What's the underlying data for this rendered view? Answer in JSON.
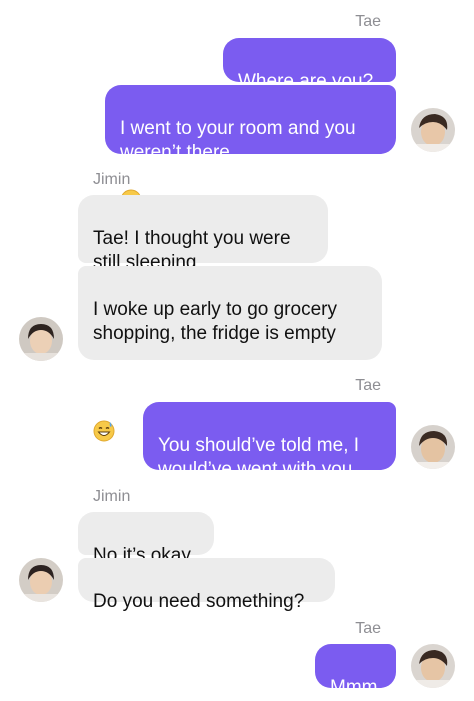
{
  "messages": {
    "tae1": {
      "sender": "Tae",
      "m1": "Where are you?",
      "m2": "I went to your room and you\nweren’t there",
      "m2_emoji": "crying-face-emoji"
    },
    "jimin1": {
      "sender": "Jimin",
      "m1": "Tae! I thought you were\nstill sleeping",
      "m2": "I woke up early to go grocery\nshopping, the fridge is empty",
      "m2_emoji": "grinning-sweat-emoji"
    },
    "tae2": {
      "sender": "Tae",
      "m1": "You should’ve told me, I\nwould’ve went with you"
    },
    "jimin2": {
      "sender": "Jimin",
      "m1": "No it’s okay",
      "m2": "Do you need something?"
    },
    "tae3": {
      "sender": "Tae",
      "m1": "Mmm"
    }
  },
  "colors": {
    "sent_bubble": "#7b5cf0",
    "received_bubble": "#ececec",
    "sender_name": "#8e8e93"
  }
}
